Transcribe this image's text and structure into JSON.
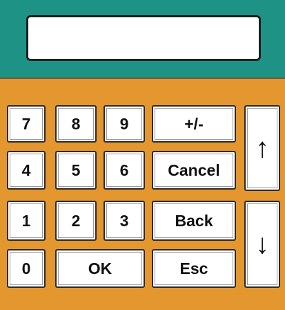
{
  "display": {
    "value": ""
  },
  "keys": {
    "k7": "7",
    "k8": "8",
    "k9": "9",
    "k4": "4",
    "k5": "5",
    "k6": "6",
    "k1": "1",
    "k2": "2",
    "k3": "3",
    "k0": "0",
    "ok": "OK",
    "plus_minus": "+/-",
    "cancel": "Cancel",
    "back": "Back",
    "esc": "Esc",
    "up": "↑",
    "down": "↓"
  },
  "colors": {
    "header_bg": "#1f9286",
    "panel_bg": "#e4962f",
    "key_bg": "#ffffff"
  },
  "icons": {
    "up": "arrow-up-icon",
    "down": "arrow-down-icon"
  }
}
